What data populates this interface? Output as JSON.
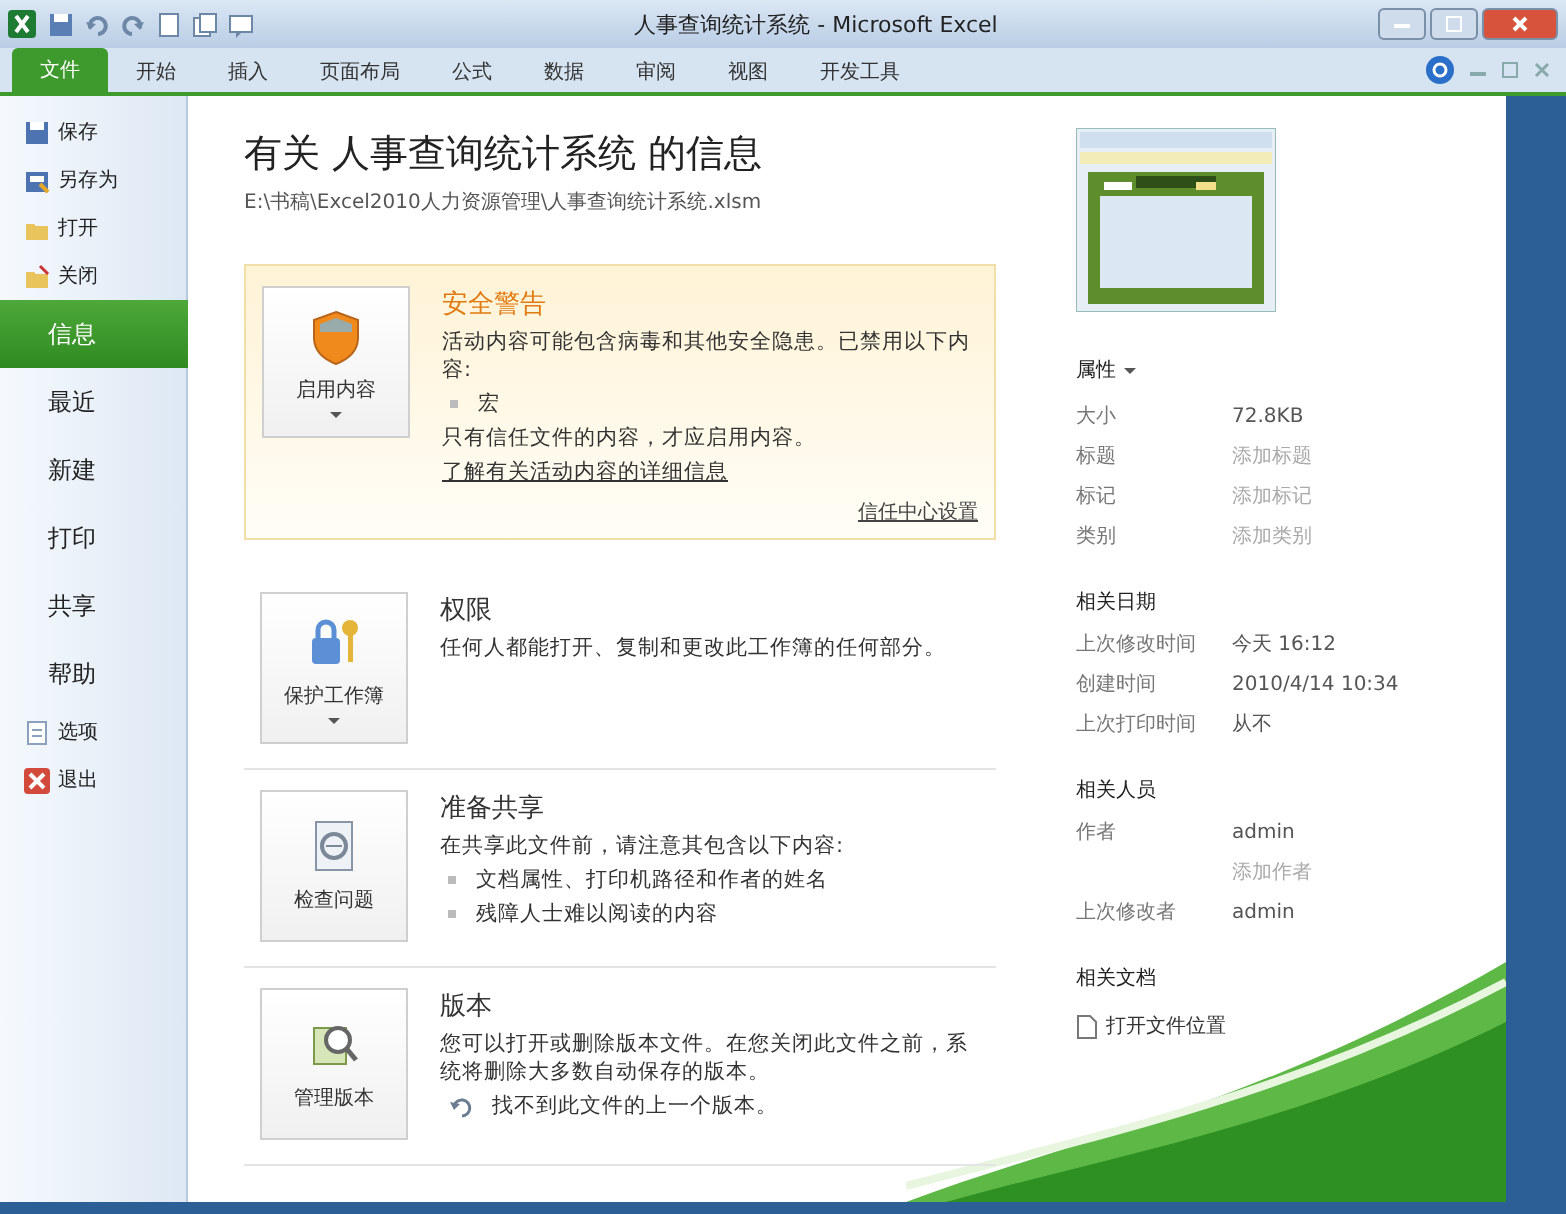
{
  "window": {
    "title": "人事查询统计系统 - Microsoft Excel"
  },
  "ribbon_tabs": [
    {
      "label": "文件",
      "selected": true
    },
    {
      "label": "开始",
      "selected": false
    },
    {
      "label": "插入",
      "selected": false
    },
    {
      "label": "页面布局",
      "selected": false
    },
    {
      "label": "公式",
      "selected": false
    },
    {
      "label": "数据",
      "selected": false
    },
    {
      "label": "审阅",
      "selected": false
    },
    {
      "label": "视图",
      "selected": false
    },
    {
      "label": "开发工具",
      "selected": false
    }
  ],
  "sidebar": {
    "items": [
      {
        "label": "保存",
        "kind": "command",
        "selected": false
      },
      {
        "label": "另存为",
        "kind": "command",
        "selected": false
      },
      {
        "label": "打开",
        "kind": "command",
        "selected": false
      },
      {
        "label": "关闭",
        "kind": "command",
        "selected": false
      },
      {
        "label": "信息",
        "kind": "page",
        "selected": true
      },
      {
        "label": "最近",
        "kind": "page",
        "selected": false
      },
      {
        "label": "新建",
        "kind": "page",
        "selected": false
      },
      {
        "label": "打印",
        "kind": "page",
        "selected": false
      },
      {
        "label": "共享",
        "kind": "page",
        "selected": false
      },
      {
        "label": "帮助",
        "kind": "page",
        "selected": false
      },
      {
        "label": "选项",
        "kind": "command",
        "selected": false
      },
      {
        "label": "退出",
        "kind": "command",
        "selected": false
      }
    ]
  },
  "info": {
    "heading": "有关 人事查询统计系统 的信息",
    "path": "E:\\书稿\\Excel2010人力资源管理\\人事查询统计系统.xlsm"
  },
  "sections": [
    {
      "kind": "warning",
      "button": {
        "label": "启用内容",
        "dropdown": true
      },
      "title": "安全警告",
      "lines": [
        {
          "kind": "text",
          "text": "活动内容可能包含病毒和其他安全隐患。已禁用以下内容:"
        },
        {
          "kind": "bullet",
          "text": "宏"
        },
        {
          "kind": "text",
          "text": "只有信任文件的内容，才应启用内容。"
        },
        {
          "kind": "link",
          "text": "了解有关活动内容的详细信息"
        }
      ],
      "footer_link": "信任中心设置"
    },
    {
      "kind": "normal",
      "button": {
        "label": "保护工作簿",
        "dropdown": true
      },
      "title": "权限",
      "lines": [
        {
          "kind": "text",
          "text": "任何人都能打开、复制和更改此工作簿的任何部分。"
        }
      ]
    },
    {
      "kind": "normal",
      "button": {
        "label": "检查问题",
        "dropdown": false
      },
      "title": "准备共享",
      "lines": [
        {
          "kind": "text",
          "text": "在共享此文件前，请注意其包含以下内容:"
        },
        {
          "kind": "bullet",
          "text": "文档属性、打印机路径和作者的姓名"
        },
        {
          "kind": "bullet",
          "text": "残障人士难以阅读的内容"
        }
      ]
    },
    {
      "kind": "normal",
      "button": {
        "label": "管理版本",
        "dropdown": false
      },
      "title": "版本",
      "lines": [
        {
          "kind": "text",
          "text": "您可以打开或删除版本文件。在您关闭此文件之前，系统将删除大多数自动保存的版本。"
        },
        {
          "kind": "note",
          "text": "找不到此文件的上一个版本。"
        }
      ]
    }
  ],
  "properties": {
    "heading": "属性",
    "groups": [
      {
        "rows": [
          {
            "label": "大小",
            "value": "72.8KB"
          },
          {
            "label": "标题",
            "placeholder": "添加标题"
          },
          {
            "label": "标记",
            "placeholder": "添加标记"
          },
          {
            "label": "类别",
            "placeholder": "添加类别"
          }
        ]
      },
      {
        "heading": "相关日期",
        "rows": [
          {
            "label": "上次修改时间",
            "value": "今天 16:12"
          },
          {
            "label": "创建时间",
            "value": "2010/4/14 10:34"
          },
          {
            "label": "上次打印时间",
            "value": "从不"
          }
        ]
      },
      {
        "heading": "相关人员",
        "rows": [
          {
            "label": "作者",
            "value": "admin"
          },
          {
            "placeholder": "添加作者"
          },
          {
            "label": "上次修改者",
            "value": "admin"
          }
        ]
      }
    ],
    "related_documents": {
      "heading": "相关文档",
      "link": "打开文件位置"
    }
  }
}
